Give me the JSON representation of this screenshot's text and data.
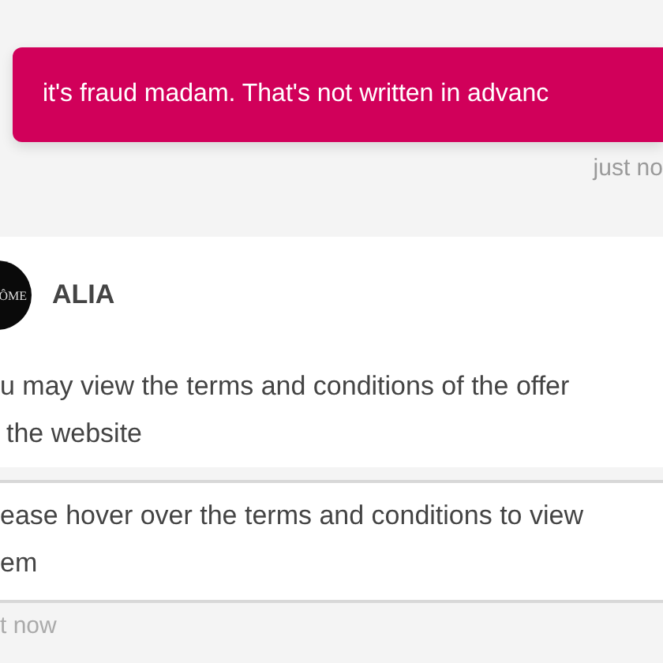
{
  "sent_message": {
    "text": "it's fraud madam. That's not written in advanc",
    "time": "just no"
  },
  "reply": {
    "avatar_text": "ÔME",
    "sender": "ALIA",
    "messages": [
      {
        "text_lines": [
          "u may view the terms and conditions of the offer",
          "the website"
        ]
      },
      {
        "text_lines": [
          "ease hover over the terms and conditions to view",
          "em"
        ]
      }
    ],
    "time": "t now"
  }
}
